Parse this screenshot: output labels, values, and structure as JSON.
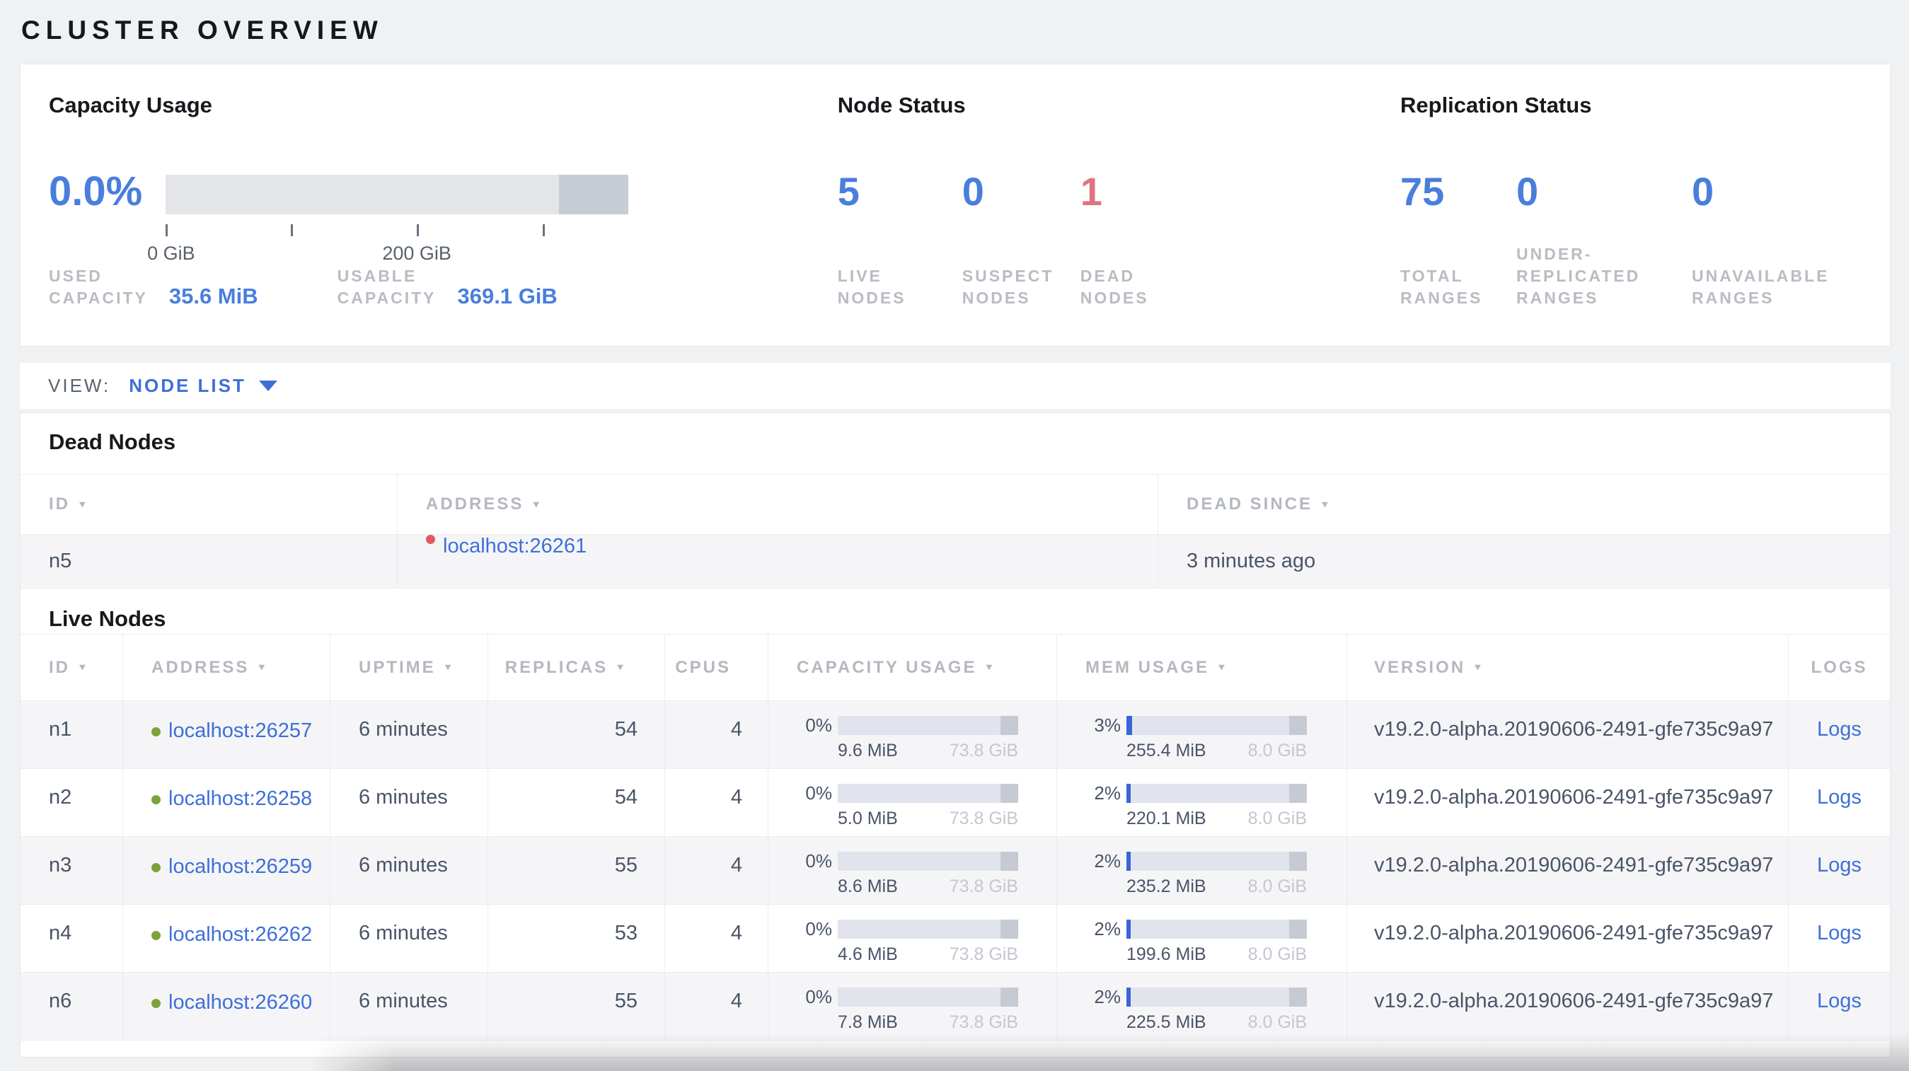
{
  "page": {
    "title": "CLUSTER OVERVIEW"
  },
  "colors": {
    "accent_blue": "#4a7edd",
    "link_blue": "#3e6fd9",
    "danger_red": "#df7480",
    "dead_dot_red": "#e05b5e",
    "live_dot_green": "#7da23b"
  },
  "overview": {
    "capacity": {
      "heading": "Capacity Usage",
      "percent": "0.0%",
      "tick_labels": [
        "0 GiB",
        "200 GiB"
      ],
      "stats": [
        {
          "label": "USED\nCAPACITY",
          "value": "35.6 MiB"
        },
        {
          "label": "USABLE\nCAPACITY",
          "value": "369.1 GiB"
        }
      ]
    },
    "node_status": {
      "heading": "Node Status",
      "stats": [
        {
          "value": "5",
          "label": "LIVE\nNODES"
        },
        {
          "value": "0",
          "label": "SUSPECT\nNODES"
        },
        {
          "value": "1",
          "label": "DEAD\nNODES"
        }
      ]
    },
    "replication": {
      "heading": "Replication Status",
      "stats": [
        {
          "value": "75",
          "label": "TOTAL\nRANGES"
        },
        {
          "value": "0",
          "label": "UNDER-\nREPLICATED\nRANGES"
        },
        {
          "value": "0",
          "label": "UNAVAILABLE\nRANGES"
        }
      ]
    }
  },
  "view_bar": {
    "label": "VIEW:",
    "selected": "NODE LIST"
  },
  "dead_nodes": {
    "heading": "Dead Nodes",
    "columns": [
      {
        "label": "ID"
      },
      {
        "label": "ADDRESS"
      },
      {
        "label": "DEAD SINCE"
      }
    ],
    "rows": [
      {
        "id": "n5",
        "address": "localhost:26261",
        "dead_since": "3 minutes ago"
      }
    ]
  },
  "live_nodes": {
    "heading": "Live Nodes",
    "columns": [
      {
        "label": "ID"
      },
      {
        "label": "ADDRESS"
      },
      {
        "label": "UPTIME"
      },
      {
        "label": "REPLICAS"
      },
      {
        "label": "CPUS"
      },
      {
        "label": "CAPACITY USAGE"
      },
      {
        "label": "MEM USAGE"
      },
      {
        "label": "VERSION"
      },
      {
        "label": "LOGS"
      }
    ],
    "rows": [
      {
        "id": "n1",
        "address": "localhost:26257",
        "uptime": "6 minutes",
        "replicas": "54",
        "cpus": "4",
        "capacity": {
          "percent": "0%",
          "fill": 0,
          "used": "9.6 MiB",
          "total": "73.8 GiB"
        },
        "memory": {
          "percent": "3%",
          "fill": 3,
          "used": "255.4 MiB",
          "total": "8.0 GiB"
        },
        "version": "v19.2.0-alpha.20190606-2491-gfe735c9a97",
        "logs_label": "Logs"
      },
      {
        "id": "n2",
        "address": "localhost:26258",
        "uptime": "6 minutes",
        "replicas": "54",
        "cpus": "4",
        "capacity": {
          "percent": "0%",
          "fill": 0,
          "used": "5.0 MiB",
          "total": "73.8 GiB"
        },
        "memory": {
          "percent": "2%",
          "fill": 2.5,
          "used": "220.1 MiB",
          "total": "8.0 GiB"
        },
        "version": "v19.2.0-alpha.20190606-2491-gfe735c9a97",
        "logs_label": "Logs"
      },
      {
        "id": "n3",
        "address": "localhost:26259",
        "uptime": "6 minutes",
        "replicas": "55",
        "cpus": "4",
        "capacity": {
          "percent": "0%",
          "fill": 0,
          "used": "8.6 MiB",
          "total": "73.8 GiB"
        },
        "memory": {
          "percent": "2%",
          "fill": 2.5,
          "used": "235.2 MiB",
          "total": "8.0 GiB"
        },
        "version": "v19.2.0-alpha.20190606-2491-gfe735c9a97",
        "logs_label": "Logs"
      },
      {
        "id": "n4",
        "address": "localhost:26262",
        "uptime": "6 minutes",
        "replicas": "53",
        "cpus": "4",
        "capacity": {
          "percent": "0%",
          "fill": 0,
          "used": "4.6 MiB",
          "total": "73.8 GiB"
        },
        "memory": {
          "percent": "2%",
          "fill": 2.5,
          "used": "199.6 MiB",
          "total": "8.0 GiB"
        },
        "version": "v19.2.0-alpha.20190606-2491-gfe735c9a97",
        "logs_label": "Logs"
      },
      {
        "id": "n6",
        "address": "localhost:26260",
        "uptime": "6 minutes",
        "replicas": "55",
        "cpus": "4",
        "capacity": {
          "percent": "0%",
          "fill": 0,
          "used": "7.8 MiB",
          "total": "73.8 GiB"
        },
        "memory": {
          "percent": "2%",
          "fill": 2.5,
          "used": "225.5 MiB",
          "total": "8.0 GiB"
        },
        "version": "v19.2.0-alpha.20190606-2491-gfe735c9a97",
        "logs_label": "Logs"
      }
    ]
  }
}
